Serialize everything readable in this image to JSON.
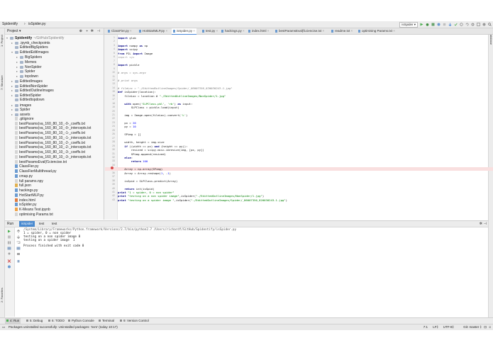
{
  "breadcrumb": {
    "root": "Spidentify",
    "file": "isSpider.py"
  },
  "run_config": {
    "name": "isSpider"
  },
  "left_tabs": {
    "project": "1: Project",
    "structure": "7: Structure",
    "favorites": "2: Favorites"
  },
  "right_tabs": {
    "database": "Database"
  },
  "project_panel": {
    "title": "Project",
    "items": [
      {
        "label": "Spidentify",
        "suffix": "~/GitHub/Spidentify",
        "kind": "folder",
        "arrow": "▾"
      },
      {
        "label": ".ipynb_checkpoints",
        "kind": "folder",
        "arrow": "▸"
      },
      {
        "label": "EdittedBigSpiders",
        "kind": "folder",
        "arrow": ""
      },
      {
        "label": "EdittedEditImages",
        "kind": "folder",
        "arrow": "▾"
      },
      {
        "label": "BigSpiders",
        "kind": "folder",
        "arrow": "▸"
      },
      {
        "label": "Memes",
        "kind": "folder",
        "arrow": "▸"
      },
      {
        "label": "NonSpider",
        "kind": "folder",
        "arrow": "▸"
      },
      {
        "label": "Spider",
        "kind": "folder",
        "arrow": "▸"
      },
      {
        "label": "topdown",
        "kind": "folder",
        "arrow": "▸"
      },
      {
        "label": "EdittedImages",
        "kind": "folder",
        "arrow": "▸"
      },
      {
        "label": "EdittedNonSpider",
        "kind": "folder",
        "arrow": "▸"
      },
      {
        "label": "EdittedOutlineImages",
        "kind": "folder",
        "arrow": "▸"
      },
      {
        "label": "EdittedSpider",
        "kind": "folder",
        "arrow": "▸"
      },
      {
        "label": "Edittedtopdown",
        "kind": "folder",
        "arrow": ""
      },
      {
        "label": "images",
        "kind": "folder",
        "arrow": "▸"
      },
      {
        "label": "Spider",
        "kind": "folder",
        "arrow": "▸"
      },
      {
        "label": "assets",
        "kind": "folder",
        "arrow": "▸"
      },
      {
        "label": ".gitignore",
        "kind": "txt",
        "arrow": ""
      },
      {
        "label": "bestParams(va_160_80_10_-0-_coeffs.txt",
        "kind": "txt",
        "arrow": ""
      },
      {
        "label": "bestParams(va_160_80_10_-0-_intercepts.txt",
        "kind": "txt",
        "arrow": ""
      },
      {
        "label": "bestParams(va_160_80_10_-1-_coeffs.txt",
        "kind": "txt",
        "arrow": ""
      },
      {
        "label": "bestParams(va_160_80_10_-1-_intercepts.txt",
        "kind": "txt",
        "arrow": ""
      },
      {
        "label": "bestParams(va_160_80_10_-2-_coeffs.txt",
        "kind": "txt",
        "arrow": ""
      },
      {
        "label": "bestParams(va_160_80_10_-2-_intercepts.txt",
        "kind": "txt",
        "arrow": ""
      },
      {
        "label": "bestParams(va_160_80_10_-3-_coeffs.txt",
        "kind": "txt",
        "arrow": ""
      },
      {
        "label": "bestParams(va_160_80_10_-3-_intercepts.txt",
        "kind": "txt",
        "arrow": ""
      },
      {
        "label": "bestParamsEval(f1ciencise.txt",
        "kind": "txt",
        "arrow": ""
      },
      {
        "label": "ClassFier.py",
        "kind": "py",
        "arrow": ""
      },
      {
        "label": "ClassFierMultithread.py",
        "kind": "py",
        "arrow": ""
      },
      {
        "label": "cmap.py",
        "kind": "py",
        "arrow": ""
      },
      {
        "label": "full params.npy",
        "kind": "txt",
        "arrow": ""
      },
      {
        "label": "full.json",
        "kind": "json",
        "arrow": ""
      },
      {
        "label": "hackings.py",
        "kind": "py",
        "arrow": ""
      },
      {
        "label": "HotStartMLP.py",
        "kind": "py",
        "arrow": ""
      },
      {
        "label": "index.html",
        "kind": "html",
        "arrow": ""
      },
      {
        "label": "isSpider.py",
        "kind": "py",
        "arrow": ""
      },
      {
        "label": "K-Means Test.ipynb",
        "kind": "ipynb",
        "arrow": ""
      },
      {
        "label": "optimising Params.txt",
        "kind": "txt",
        "arrow": ""
      }
    ]
  },
  "editor_tabs": [
    {
      "label": "ClassFier.py",
      "active": false
    },
    {
      "label": "HotStartMLP.py",
      "active": false
    },
    {
      "label": "isSpider.py",
      "active": true
    },
    {
      "label": "test.py",
      "active": false
    },
    {
      "label": "hackings.py",
      "active": false
    },
    {
      "label": "index.html",
      "active": false
    },
    {
      "label": "bestParamsEval(f1ciencise.txt",
      "active": false
    },
    {
      "label": "readme.txt",
      "active": false
    },
    {
      "label": "optimising Params.txt",
      "active": false
    }
  ],
  "code_lines": [
    "import glob",
    "",
    "import numpy as np",
    "import scipy",
    "from PIL import Image",
    "import sys",
    "",
    "import pickle",
    "",
    "# args = sys.argv",
    "",
    "# print args",
    "",
    "# fileLoc = \"./EdittedOutlineImages/Spider/_86007350_820030243-1.jpg\"",
    "def isSpider(location):",
    "    fileLoc = location # \"./EdittedOutlineImages/NonSpider/1.jpg\"",
    "",
    "    with open('SLPClass.pkl', 'rb') as input:",
    "        SLPClass = pickle.load(input)",
    "",
    "    img = Image.open(fileLoc).convert('L')",
    "",
    "    px = 20",
    "    py = 10",
    "",
    "    SPimg = []",
    "",
    "    width, height = img.size",
    "    if ((width == px) and (height == py)):",
    "        resized = scipy.misc.imresize(img, [px, py])",
    "        SPimg.append(resized)",
    "    else:",
    "        return 100",
    "",
    "    Array = np.array(SPimg)",
    "    Array = Array.reshape(1, -1)",
    "",
    "    isSpid = SLPClass.predict(Array)",
    "",
    "    return int(isSpid)",
    "print \"1 = spider, 0 = non spider\"",
    "print \"testing on a non spider image\",isSpider(\"./EdittedOutlineImages/NonSpider/1.jpg\")",
    "print \"testing on a spider image \",isSpider(\"./EdittedOutlineImages/Spider/_86007350_820030243-1.jpg\")"
  ],
  "run_panel": {
    "title": "Run",
    "tabs": [
      "isSpider",
      "test",
      "test"
    ],
    "output": [
      "/System/Library/Frameworks/Python.framework/Versions/2.7/bin/python2.7 /Users/richardf/GitHub/Spidentify/isSpider.py",
      "1 = spider, 0 = non spider",
      "testing on a non spider image 0",
      "testing on a spider image  1",
      "",
      "Process finished with exit code 0"
    ]
  },
  "bottom_tabs": [
    "4: Run",
    "5: Debug",
    "6: TODO",
    "Python Console",
    "Terminal",
    "9: Version Control"
  ],
  "status": {
    "message": "Packages uninstalled successfully: Uninstalled packages: 'nvm' (today 10:17)",
    "position": "7:1",
    "line_ending": "LF‡",
    "encoding": "UTF-8‡",
    "git": "Git: master ‡"
  }
}
